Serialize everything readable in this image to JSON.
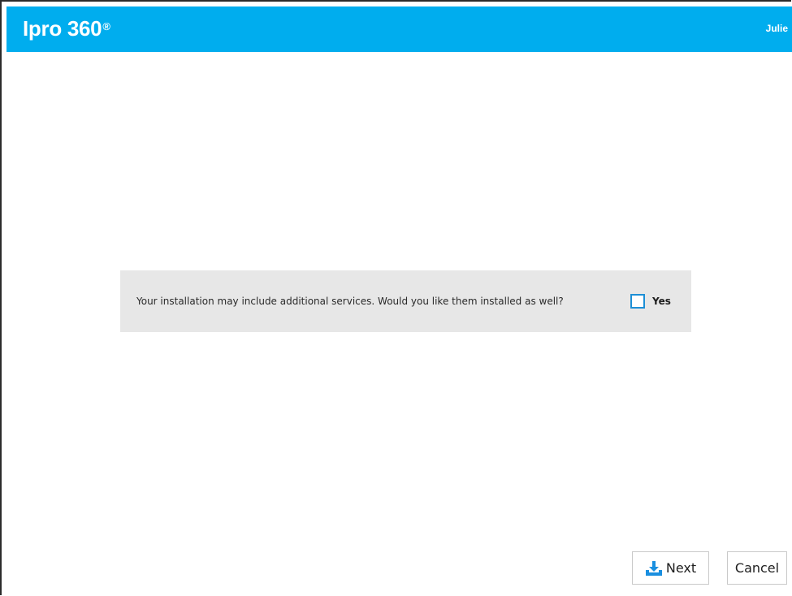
{
  "header": {
    "app_title": "Ipro 360",
    "app_title_mark": "®",
    "user_name": "Julie"
  },
  "prompt": {
    "question": "Your installation may include additional services. Would you like them installed as well?",
    "checkbox_checked": false,
    "checkbox_label": "Yes"
  },
  "footer": {
    "next_label": "Next",
    "next_icon": "download-icon",
    "cancel_label": "Cancel"
  },
  "colors": {
    "header_bg": "#00adee",
    "panel_bg": "#e7e7e7",
    "checkbox_border": "#1d8fd6",
    "icon_blue": "#1a8fe0"
  }
}
